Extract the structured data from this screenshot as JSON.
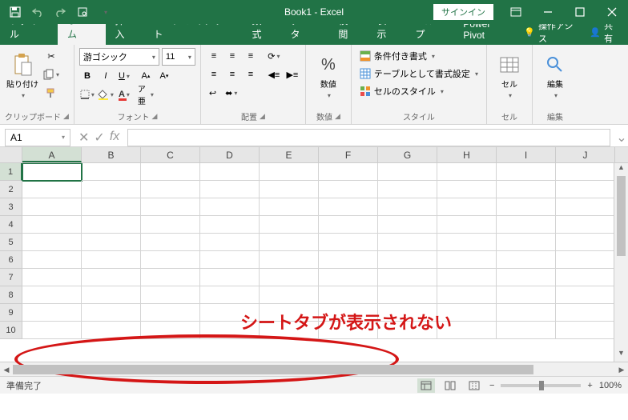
{
  "titlebar": {
    "title": "Book1 - Excel",
    "signin": "サインイン"
  },
  "tabs": {
    "file": "ファイル",
    "home": "ホーム",
    "insert": "挿入",
    "page_layout": "ページ レイアウト",
    "formulas": "数式",
    "data": "データ",
    "review": "校閲",
    "view": "表示",
    "help": "ヘルプ",
    "power_pivot": "Power Pivot",
    "tell_me": "操作アシス",
    "share": "共有"
  },
  "ribbon": {
    "clipboard": {
      "paste_label": "貼り付け",
      "group_label": "クリップボード"
    },
    "font": {
      "name": "游ゴシック",
      "size": "11",
      "group_label": "フォント"
    },
    "alignment": {
      "group_label": "配置"
    },
    "number": {
      "label": "数値",
      "group_label": "数値"
    },
    "styles": {
      "conditional": "条件付き書式",
      "table": "テーブルとして書式設定",
      "cell": "セルのスタイル",
      "group_label": "スタイル"
    },
    "cells": {
      "label": "セル",
      "group_label": "セル"
    },
    "editing": {
      "label": "編集",
      "group_label": "編集"
    }
  },
  "namebox": {
    "value": "A1"
  },
  "columns": [
    "A",
    "B",
    "C",
    "D",
    "E",
    "F",
    "G",
    "H",
    "I",
    "J"
  ],
  "rows": [
    "1",
    "2",
    "3",
    "4",
    "5",
    "6",
    "7",
    "8",
    "9",
    "10"
  ],
  "statusbar": {
    "ready": "準備完了",
    "zoom": "100%"
  },
  "annotation": {
    "text": "シートタブが表示されない"
  }
}
